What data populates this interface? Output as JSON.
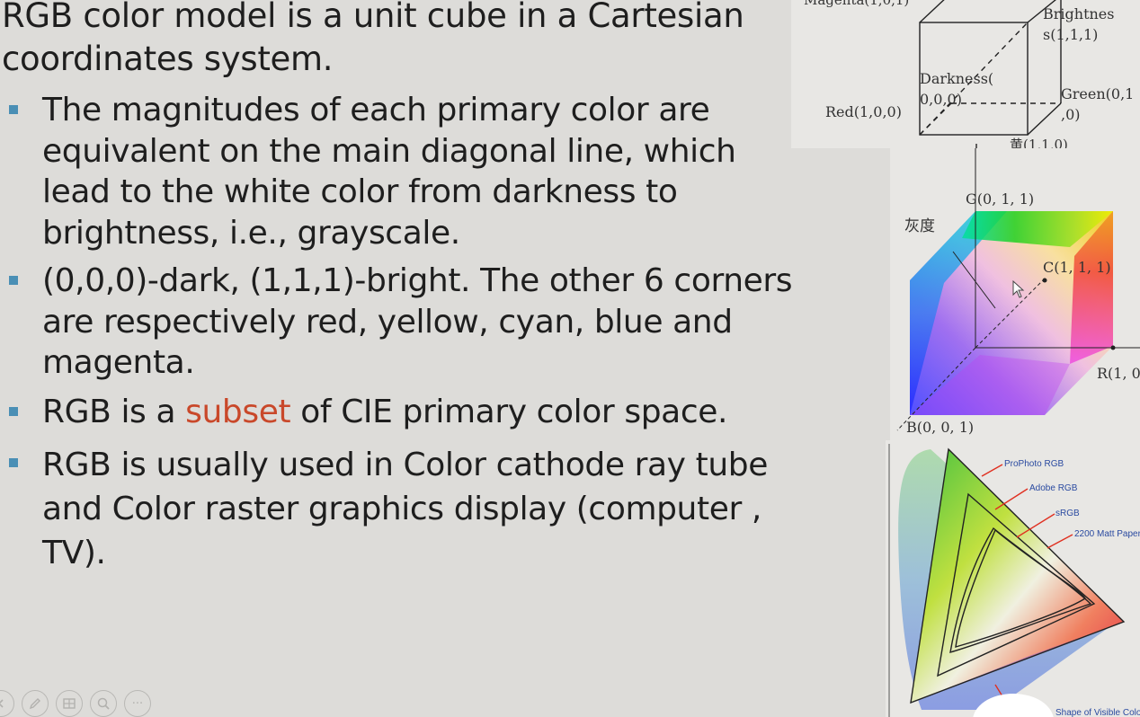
{
  "slide": {
    "title": "RGB color model is a unit cube in a Cartesian coordinates system.",
    "bullets": [
      {
        "text": "The magnitudes of each primary color are equivalent on the main diagonal line, which lead to the white color from darkness to brightness, i.e., grayscale."
      },
      {
        "text": "(0,0,0)-dark, (1,1,1)-bright. The other 6 corners are respectively red, yellow, cyan, blue and magenta."
      },
      {
        "pre": "RGB is a ",
        "highlight": "subset",
        "post": " of CIE primary color space."
      },
      {
        "text": "RGB is usually used in Color cathode ray tube and Color raster graphics display (computer , TV)."
      }
    ],
    "highlight_color": "#c9482a",
    "bullet_color": "#4a8fb5"
  },
  "cube_diagram": {
    "magenta": "Magenta(1,0,1)",
    "brightness_1": "Brightnes",
    "brightness_2": "s(1,1,1)",
    "darkness_1": "Darkness(",
    "darkness_2": "0,0,0)",
    "red": "Red(1,0,0)",
    "green_1": "Green(0,1",
    "green_2": ",0)",
    "yellow": "黄(1,1,0)"
  },
  "color_cube": {
    "g": "G(0, 1, 1)",
    "gray": "灰度",
    "c": "C(1, 1, 1)",
    "r": "R(1, 0",
    "b": "B(0, 0, 1)"
  },
  "gamut_diagram": {
    "prophoto": "ProPhoto RGB",
    "adobe": "Adobe RGB",
    "srgb": "sRGB",
    "matt": "2200 Matt Paper",
    "shape": "Shape of Visible Colo"
  },
  "toolbar": {
    "icons": [
      "prev-icon",
      "pen-icon",
      "slides-grid-icon",
      "zoom-icon",
      "more-options-icon"
    ],
    "more_label": "···"
  }
}
